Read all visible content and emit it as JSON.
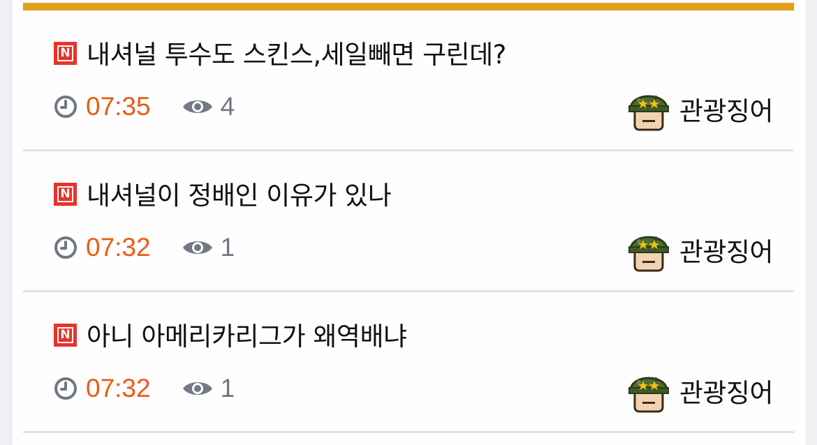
{
  "posts": [
    {
      "badge": "N",
      "title": "내셔널 투수도 스킨스,세일빼면 구린데?",
      "time": "07:35",
      "views": "4",
      "author": "관광징어"
    },
    {
      "badge": "N",
      "title": "내셔널이 정배인 이유가 있나",
      "time": "07:32",
      "views": "1",
      "author": "관광징어"
    },
    {
      "badge": "N",
      "title": "아니 아메리카리그가 왜역배냐",
      "time": "07:32",
      "views": "1",
      "author": "관광징어"
    }
  ],
  "icons": {
    "badge": "new-badge-icon",
    "time": "clock-icon",
    "views": "eye-icon",
    "avatar": "soldier-avatar-icon"
  },
  "colors": {
    "accent_bar": "#e09e1c",
    "badge": "#e8322a",
    "time": "#ec5a13",
    "views": "#6f7782",
    "divider": "#dfe1e8"
  }
}
